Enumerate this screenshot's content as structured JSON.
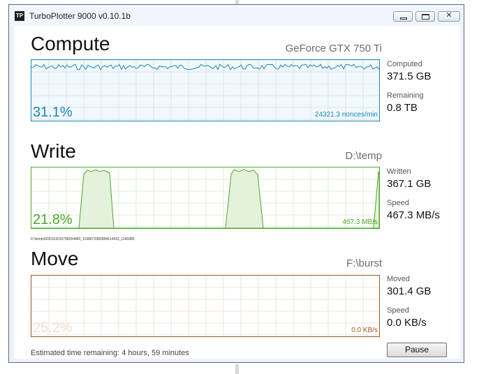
{
  "window": {
    "title": "TurboPlotter 9000 v0.10.1b",
    "icon": "TP"
  },
  "compute": {
    "title": "Compute",
    "device": "GeForce GTX 750 Ti",
    "percent": "31.1%",
    "rate": "24321.3 nonces/min",
    "color": "#1a87b8",
    "computed_label": "Computed",
    "computed_value": "371.5 GB",
    "remaining_label": "Remaining",
    "remaining_value": "0.8 TB"
  },
  "write": {
    "title": "Write",
    "path": "D:\\temp",
    "percent": "21.8%",
    "rate": "467.3 MB/s",
    "color": "#4ea52a",
    "file_path": "D:\\temp\\6035119010798254480_1198672980584614432_1146986",
    "written_label": "Written",
    "written_value": "367.1 GB",
    "speed_label": "Speed",
    "speed_value": "467.3 MB/s"
  },
  "move": {
    "title": "Move",
    "path": "F:\\burst",
    "percent": "25.2%",
    "rate": "0.0 KB/s",
    "color": "#9a5a1a",
    "moved_label": "Moved",
    "moved_value": "301.4 GB",
    "speed_label": "Speed",
    "speed_value": "0.0 KB/s"
  },
  "footer": {
    "estimated": "Estimated time remaining: 4 hours, 59 minutes",
    "pause_label": "Pause"
  }
}
